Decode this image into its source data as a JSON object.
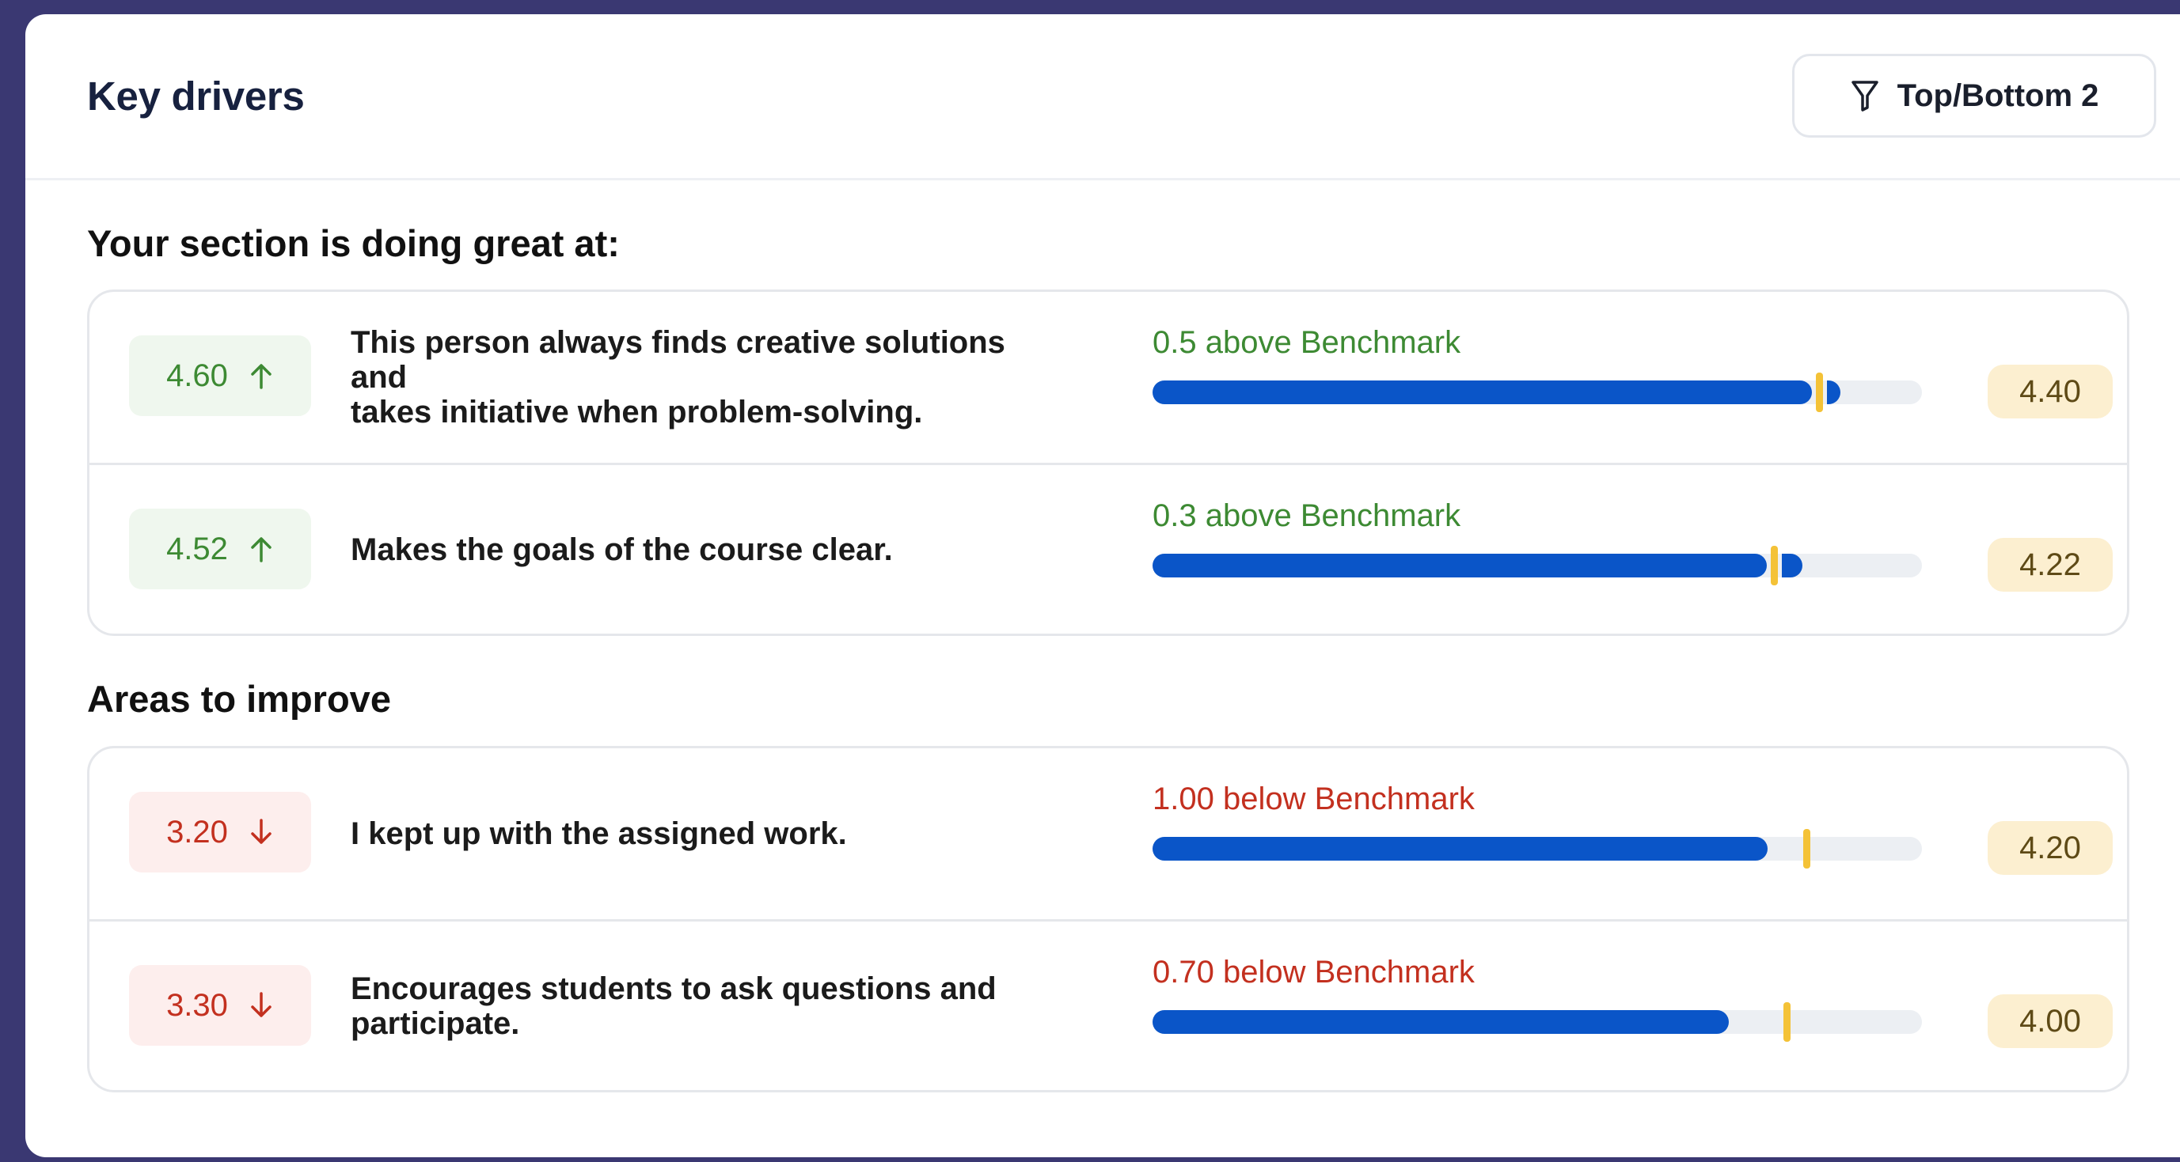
{
  "card": {
    "title": "Key drivers",
    "filter_label": "Top/Bottom 2"
  },
  "sections": {
    "great": {
      "heading": "Your section is doing great at:",
      "rows": [
        {
          "score": "4.60",
          "direction": "up",
          "question_line1": "This person always finds creative solutions and",
          "question_line2": "takes initiative when problem-solving.",
          "bench_label": "0.5 above Benchmark",
          "bench_value": "4.40",
          "score_num": 4.6,
          "bench_num": 4.4
        },
        {
          "score": "4.52",
          "direction": "up",
          "question_line1": "Makes the goals of the course clear.",
          "question_line2": "",
          "bench_label": "0.3 above Benchmark",
          "bench_value": "4.22",
          "score_num": 4.52,
          "bench_num": 4.22
        }
      ]
    },
    "improve": {
      "heading": "Areas to improve",
      "rows": [
        {
          "score": "3.20",
          "direction": "down",
          "question_line1": "I kept up with the assigned work.",
          "question_line2": "",
          "bench_label": "1.00 below Benchmark",
          "bench_value": "4.20",
          "score_num": 3.2,
          "bench_num": 4.2
        },
        {
          "score": "3.30",
          "direction": "down",
          "question_line1": "Encourages students to ask questions and",
          "question_line2": "participate.",
          "bench_label": "0.70 below Benchmark",
          "bench_value": "4.00",
          "score_num": 3.3,
          "bench_num": 4.0
        }
      ]
    }
  },
  "icons": {
    "filter": "filter-funnel-icon",
    "up": "arrow-up-icon",
    "down": "arrow-down-icon"
  },
  "colors": {
    "positive": "#3d8a33",
    "negative": "#c3301f",
    "bar": "#0a55c8",
    "benchmark_marker": "#f4c237",
    "benchmark_badge_bg": "#fcefd0"
  }
}
